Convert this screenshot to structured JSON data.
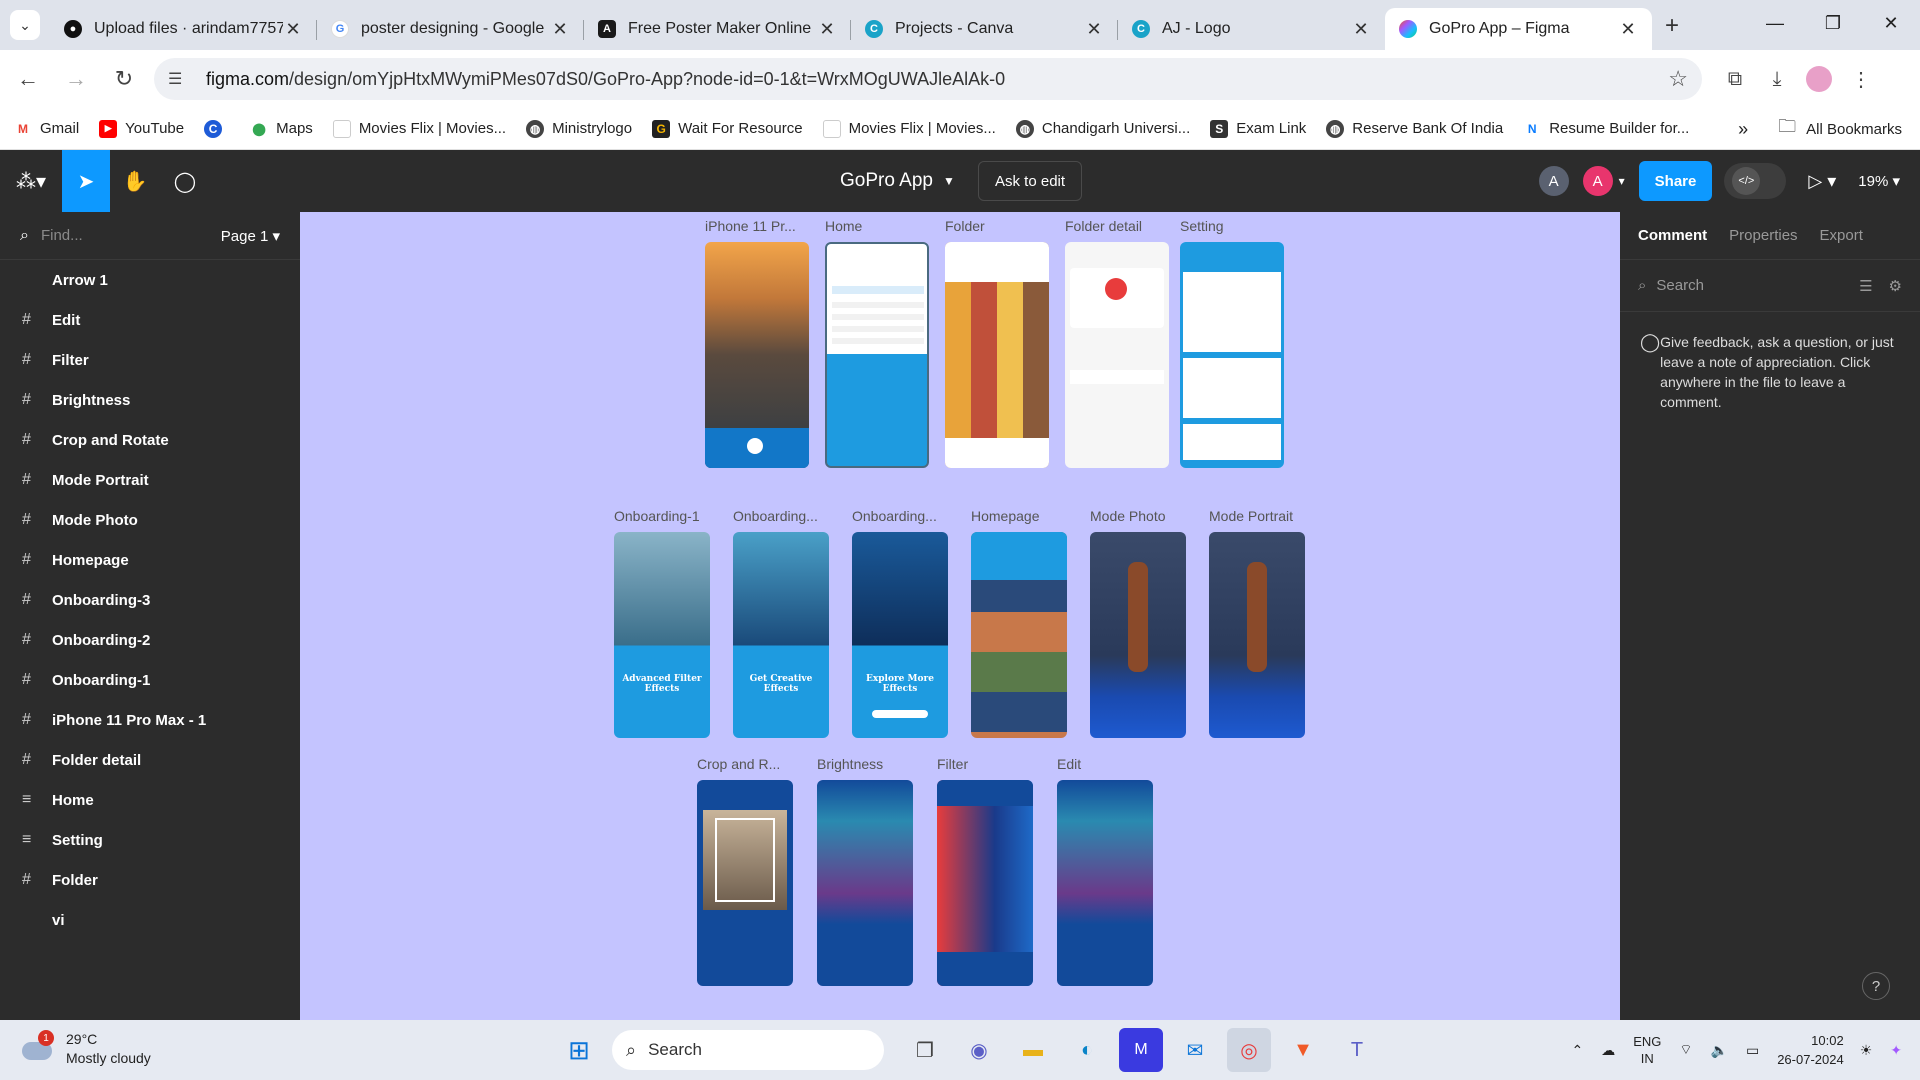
{
  "browser": {
    "tabs": [
      {
        "title": "Upload files · arindam7757",
        "favicon": "github-icon",
        "active": false
      },
      {
        "title": "poster designing - Google",
        "favicon": "google-icon",
        "active": false
      },
      {
        "title": "Free Poster Maker Online |",
        "favicon": "adobe-express-icon",
        "active": false
      },
      {
        "title": "Projects - Canva",
        "favicon": "canva-icon",
        "active": false
      },
      {
        "title": "AJ - Logo",
        "favicon": "canva-icon",
        "active": false
      },
      {
        "title": "GoPro App – Figma",
        "favicon": "figma-icon",
        "active": true
      }
    ],
    "url_host": "figma.com",
    "url_path": "/design/omYjpHtxMWymiPMes07dS0/GoPro-App?node-id=0-1&t=WrxMOgUWAJleAlAk-0",
    "bookmarks": [
      {
        "label": "Gmail",
        "icon": "gmail-icon"
      },
      {
        "label": "YouTube",
        "icon": "youtube-icon"
      },
      {
        "label": "",
        "icon": "c-icon"
      },
      {
        "label": "Maps",
        "icon": "maps-icon"
      },
      {
        "label": "Movies Flix | Movies...",
        "icon": "page-icon"
      },
      {
        "label": "Ministrylogo",
        "icon": "globe-icon"
      },
      {
        "label": "Wait For Resource",
        "icon": "g-icon"
      },
      {
        "label": "Movies Flix | Movies...",
        "icon": "page-icon"
      },
      {
        "label": "Chandigarh Universi...",
        "icon": "globe-icon"
      },
      {
        "label": "Exam Link",
        "icon": "s-icon"
      },
      {
        "label": "Reserve Bank Of India",
        "icon": "globe-icon"
      },
      {
        "label": "Resume Builder for...",
        "icon": "n-icon"
      }
    ],
    "all_bookmarks": "All Bookmarks"
  },
  "figma": {
    "file_title": "GoPro App",
    "ask_to_edit": "Ask to edit",
    "avatar_1": "A",
    "avatar_2": "A",
    "share": "Share",
    "zoom": "19%",
    "find_placeholder": "Find...",
    "page": "Page 1",
    "layers": [
      {
        "name": "Arrow 1",
        "icon": "arrow-icon"
      },
      {
        "name": "Edit",
        "icon": "frame-icon"
      },
      {
        "name": "Filter",
        "icon": "frame-icon"
      },
      {
        "name": "Brightness",
        "icon": "frame-icon"
      },
      {
        "name": "Crop and Rotate",
        "icon": "frame-icon"
      },
      {
        "name": "Mode Portrait",
        "icon": "frame-icon"
      },
      {
        "name": "Mode Photo",
        "icon": "frame-icon"
      },
      {
        "name": "Homepage",
        "icon": "frame-icon"
      },
      {
        "name": "Onboarding-3",
        "icon": "frame-icon"
      },
      {
        "name": "Onboarding-2",
        "icon": "frame-icon"
      },
      {
        "name": "Onboarding-1",
        "icon": "frame-icon"
      },
      {
        "name": "iPhone 11 Pro Max - 1",
        "icon": "frame-icon"
      },
      {
        "name": "Folder detail",
        "icon": "frame-icon"
      },
      {
        "name": "Home",
        "icon": "list-icon"
      },
      {
        "name": "Setting",
        "icon": "list-icon"
      },
      {
        "name": "Folder",
        "icon": "frame-icon"
      },
      {
        "name": "vi",
        "icon": "empty-icon"
      }
    ],
    "frames_row1": [
      "iPhone 11 Pr...",
      "Home",
      "Folder",
      "Folder detail",
      "Setting"
    ],
    "frames_row2": [
      "Onboarding-1",
      "Onboarding...",
      "Onboarding...",
      "Homepage",
      "Mode Photo",
      "Mode Portrait"
    ],
    "frames_row3": [
      "Crop and R...",
      "Brightness",
      "Filter",
      "Edit"
    ],
    "onboarding_captions": [
      "Advanced Filter Effects",
      "Get Creative Effects",
      "Explore More Effects"
    ],
    "right_tabs": [
      "Comment",
      "Properties",
      "Export"
    ],
    "right_search": "Search",
    "comment_hint": "Give feedback, ask a question, or just leave a note of appreciation. Click anywhere in the file to leave a comment.",
    "help": "?"
  },
  "taskbar": {
    "temperature": "29°C",
    "weather": "Mostly cloudy",
    "weather_badge": "1",
    "search": "Search",
    "lang_1": "ENG",
    "lang_2": "IN",
    "time": "10:02",
    "date": "26-07-2024"
  },
  "colors": {
    "figma_blue": "#0d99ff",
    "canvas": "#c4c4ff",
    "figma_dark": "#2c2c2c"
  }
}
